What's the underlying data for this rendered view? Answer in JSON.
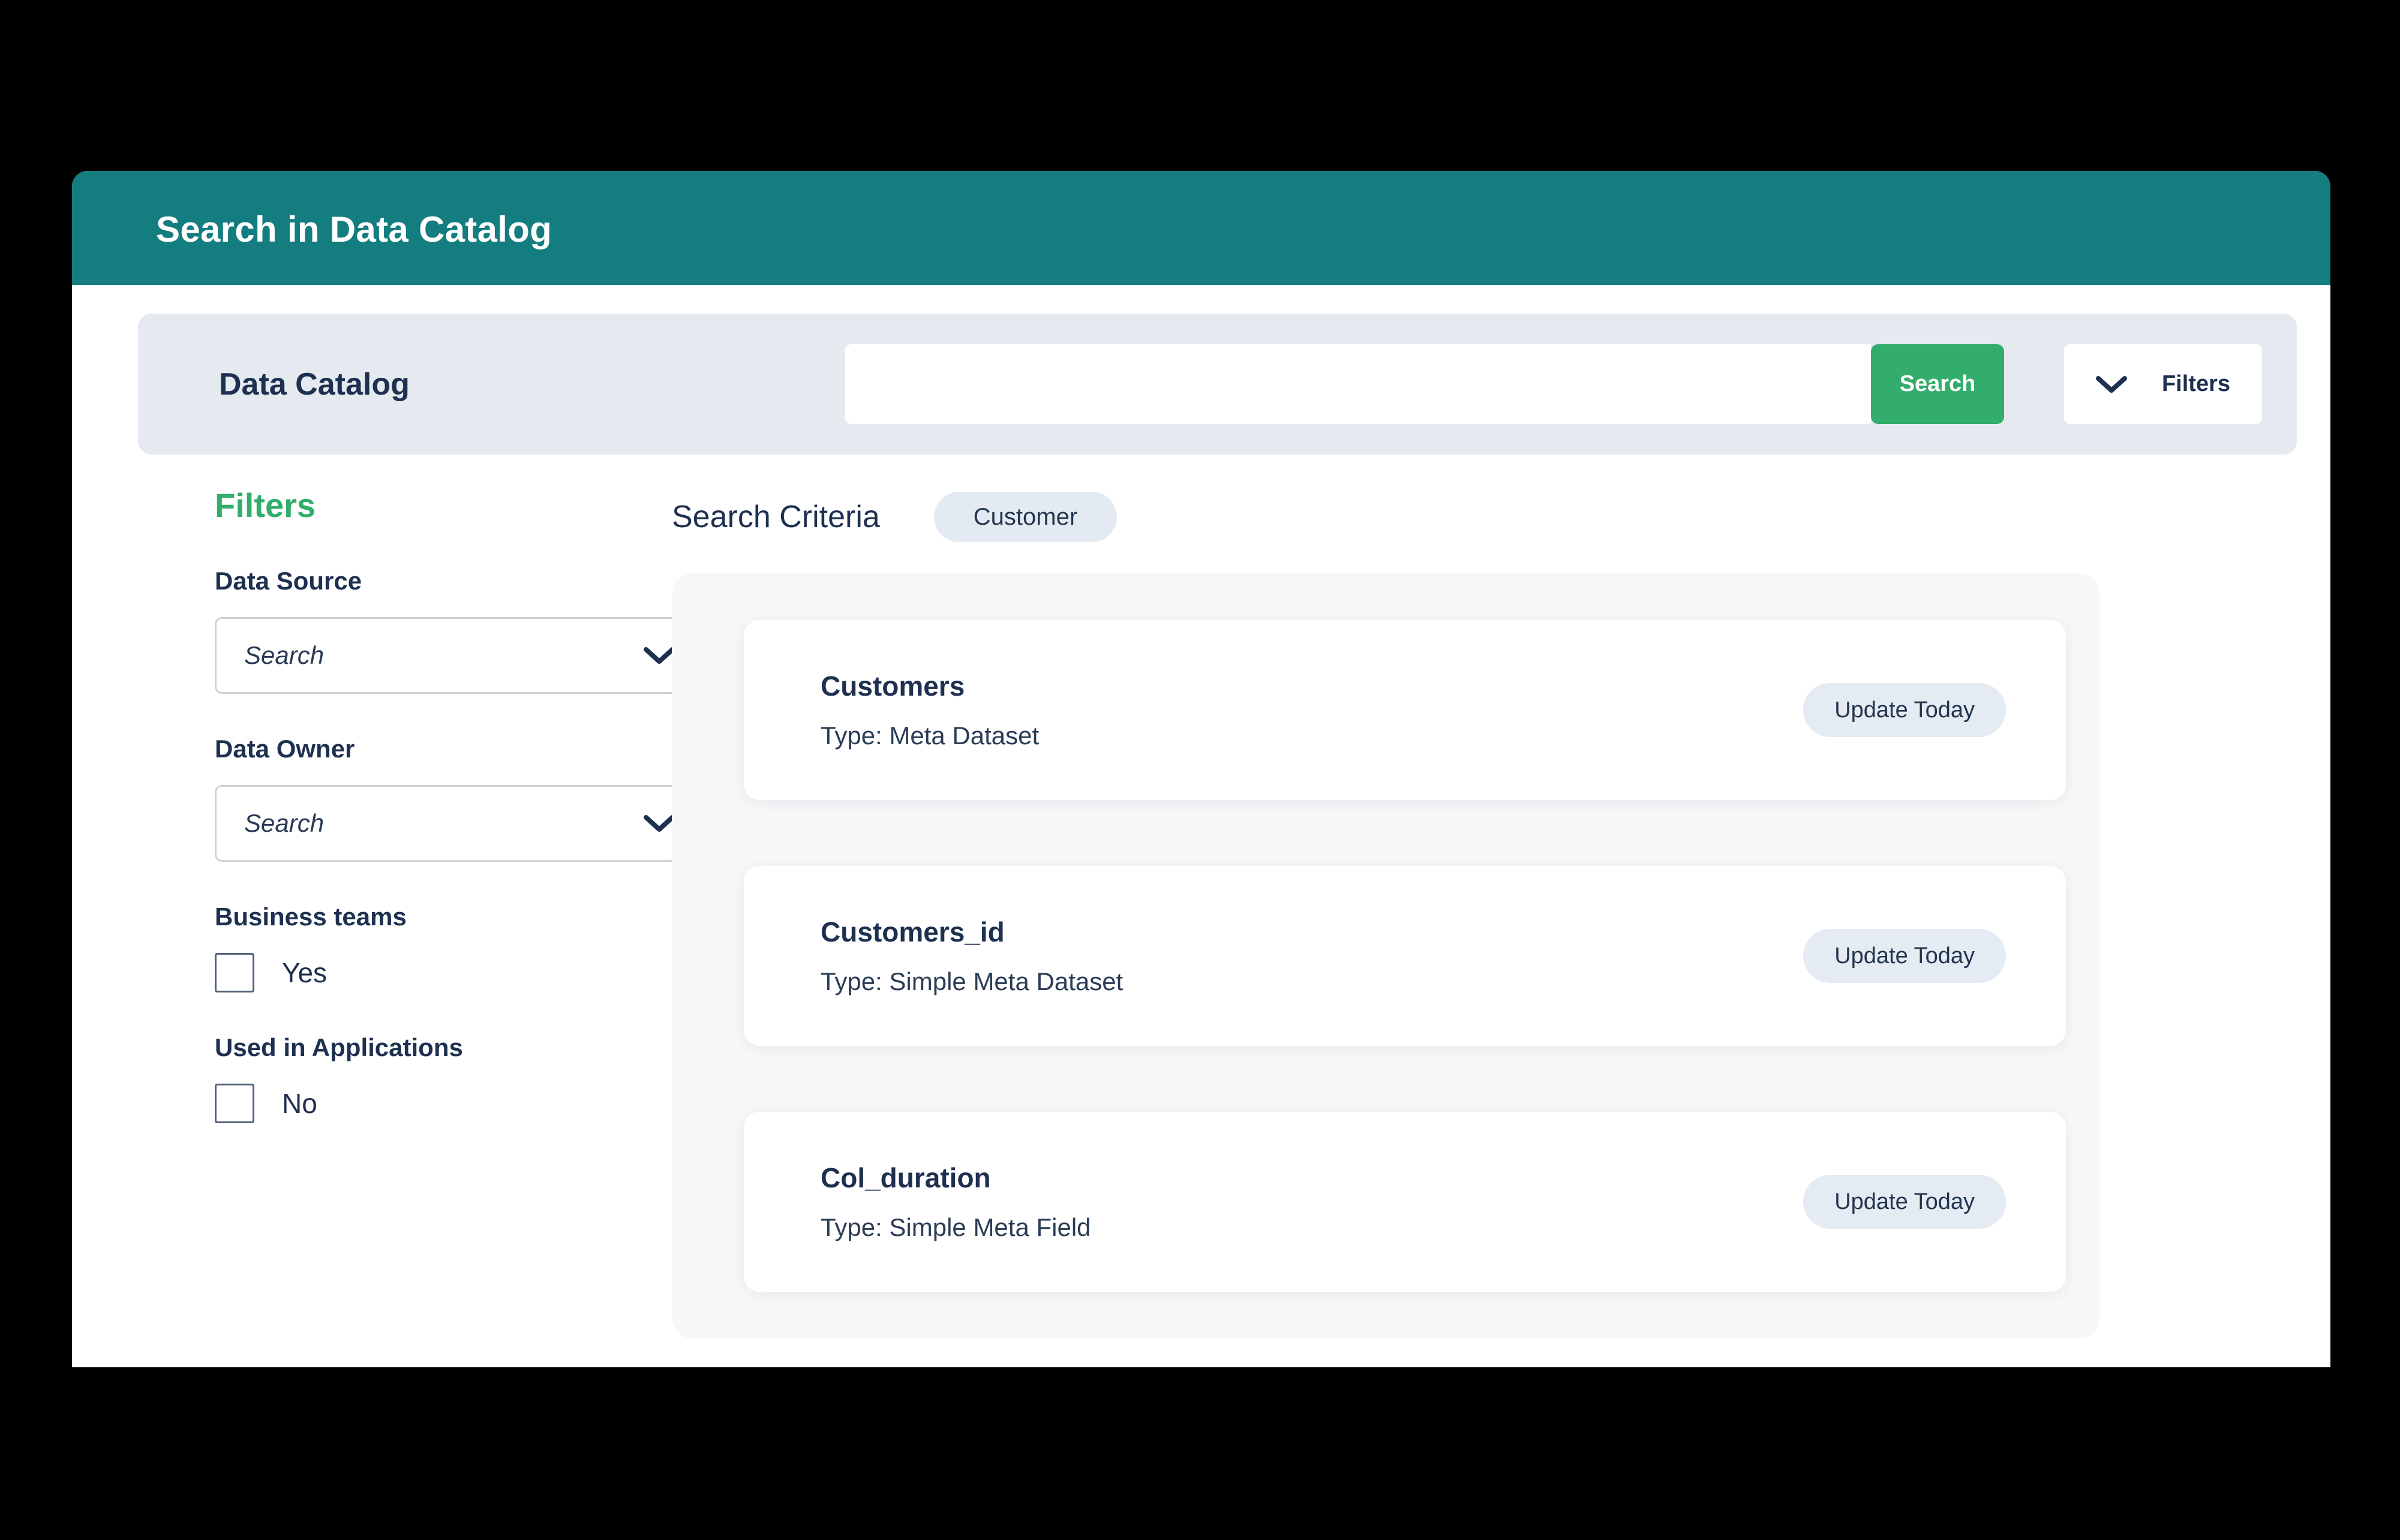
{
  "window": {
    "title": "Search in Data Catalog"
  },
  "search_panel": {
    "heading": "Data Catalog",
    "search_value": "",
    "search_placeholder": "",
    "search_button": "Search",
    "filters_button": "Filters",
    "chevron_icon": "chevron-down-icon"
  },
  "sidebar": {
    "heading": "Filters",
    "fields": [
      {
        "label": "Data Source",
        "placeholder": "Search",
        "value": "",
        "chevron_icon": "chevron-down-icon"
      },
      {
        "label": "Data Owner",
        "placeholder": "Search",
        "value": "",
        "chevron_icon": "chevron-down-icon"
      }
    ],
    "checkbox_groups": [
      {
        "label": "Business teams",
        "option": "Yes",
        "checked": false
      },
      {
        "label": "Used in Applications",
        "option": "No",
        "checked": false
      }
    ]
  },
  "results": {
    "criteria_label": "Search Criteria",
    "criteria_chips": [
      "Customer"
    ],
    "items": [
      {
        "title": "Customers",
        "type": "Type: Meta Dataset",
        "action": "Update Today"
      },
      {
        "title": "Customers_id",
        "type": "Type: Simple Meta Dataset",
        "action": "Update Today"
      },
      {
        "title": "Col_duration",
        "type": "Type: Simple Meta Field",
        "action": "Update Today"
      }
    ]
  },
  "colors": {
    "title_bar": "#147d80",
    "accent_green": "#32ad6b",
    "navy_text": "#1e3050",
    "panel_bg": "#e5eaf1",
    "chip_bg": "#e3eaf1",
    "pill_bg": "#e4ebf2",
    "results_bg": "#f6f7f8",
    "page_bg": "#000000"
  }
}
